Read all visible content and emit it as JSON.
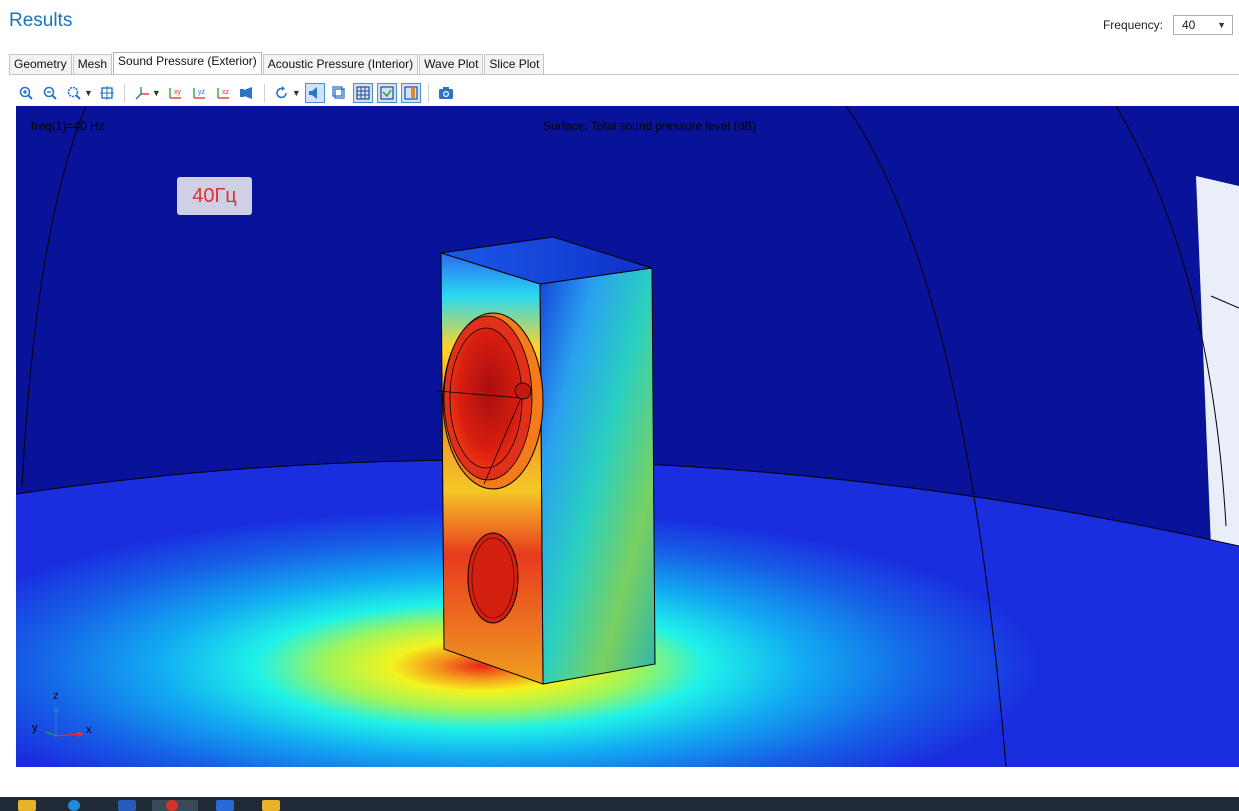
{
  "header": {
    "title": "Results",
    "frequency_label": "Frequency:",
    "frequency_value": "40"
  },
  "tabs": [
    {
      "label": "Geometry",
      "active": false
    },
    {
      "label": "Mesh",
      "active": false
    },
    {
      "label": "Sound Pressure (Exterior)",
      "active": true
    },
    {
      "label": "Acoustic Pressure (Interior)",
      "active": false
    },
    {
      "label": "Wave Plot",
      "active": false
    },
    {
      "label": "Slice Plot",
      "active": false
    }
  ],
  "toolbar": {
    "zoom_in": "zoom-in-icon",
    "zoom_out": "zoom-out-icon",
    "zoom_box": "zoom-box-icon",
    "zoom_extents": "zoom-extents-icon",
    "axis_views": [
      "xy",
      "yz",
      "xz"
    ]
  },
  "viewport": {
    "freq_text": "freq(1)=40 Hz",
    "surface_text": "Surface: Total sound pressure level (dB)",
    "badge": "40Гц",
    "axis_z": "z",
    "axis_y": "y",
    "axis_x": "x"
  },
  "colors": {
    "title": "#1f73b7",
    "background_field": "#08139a",
    "badge_text": "#e0302a"
  }
}
